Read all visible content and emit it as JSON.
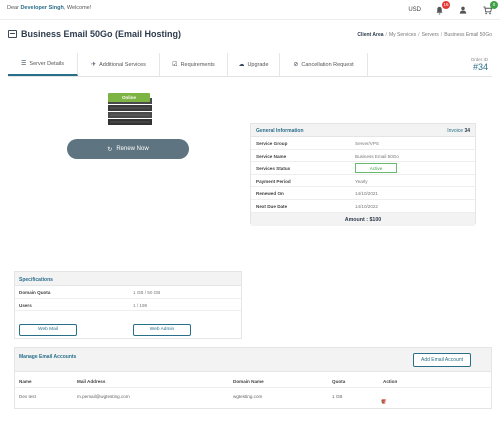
{
  "topbar": {
    "welcome_prefix": "Dear ",
    "user_name": "Developer Singh",
    "welcome_suffix": ", Welcome!",
    "currency": "USD",
    "notification_count": "16",
    "cart_count": "0"
  },
  "header": {
    "title": "Business Email 50Go (Email Hosting)",
    "breadcrumb": [
      "Client Area",
      "My Services",
      "Servers",
      "Business Email 50Go"
    ]
  },
  "tabs": [
    {
      "label": "Server Details",
      "icon": "list-icon"
    },
    {
      "label": "Additional Services",
      "icon": "plane-icon"
    },
    {
      "label": "Requirements",
      "icon": "check-square-icon"
    },
    {
      "label": "Upgrade",
      "icon": "cloud-icon"
    },
    {
      "label": "Cancellation Request",
      "icon": "ban-icon"
    }
  ],
  "order": {
    "label": "Order ID",
    "number": "#34"
  },
  "server": {
    "status_tag": "Online",
    "renew_label": "Renew Now"
  },
  "general_info": {
    "title": "General Information",
    "invoice_label": "Invoice",
    "invoice_number": "34",
    "rows": [
      {
        "key": "Service Group",
        "value": "Server/VPS"
      },
      {
        "key": "Service Name",
        "value": "Business Email 50Go"
      },
      {
        "key": "Services Status",
        "value": "Active"
      },
      {
        "key": "Payment Period",
        "value": "Yearly"
      },
      {
        "key": "Renewed On",
        "value": "14/10/2021"
      },
      {
        "key": "Next Due Date",
        "value": "14/10/2022"
      }
    ],
    "amount": "Amount : $100"
  },
  "specifications": {
    "title": "Specifications",
    "rows": [
      {
        "key": "Domain Quota",
        "value": "1 GB / 50 GB"
      },
      {
        "key": "Users",
        "value": "1 / 199"
      }
    ],
    "webmail_label": "Web Mail",
    "webadmin_label": "Web Admin"
  },
  "email_accounts": {
    "title": "Manage Email Accounts",
    "add_label": "Add Email Account",
    "columns": [
      "Name",
      "Mail Address",
      "Domain Name",
      "Quota",
      "Action"
    ],
    "rows": [
      {
        "name": "Dev test",
        "mail": "m.pemail@wgtesting.com",
        "domain": "wgtesting.com",
        "quota": "1 GB"
      }
    ]
  },
  "colors": {
    "accent": "#2a6f8a",
    "online": "#7cb342",
    "active": "#43a047",
    "danger": "#e53935"
  }
}
